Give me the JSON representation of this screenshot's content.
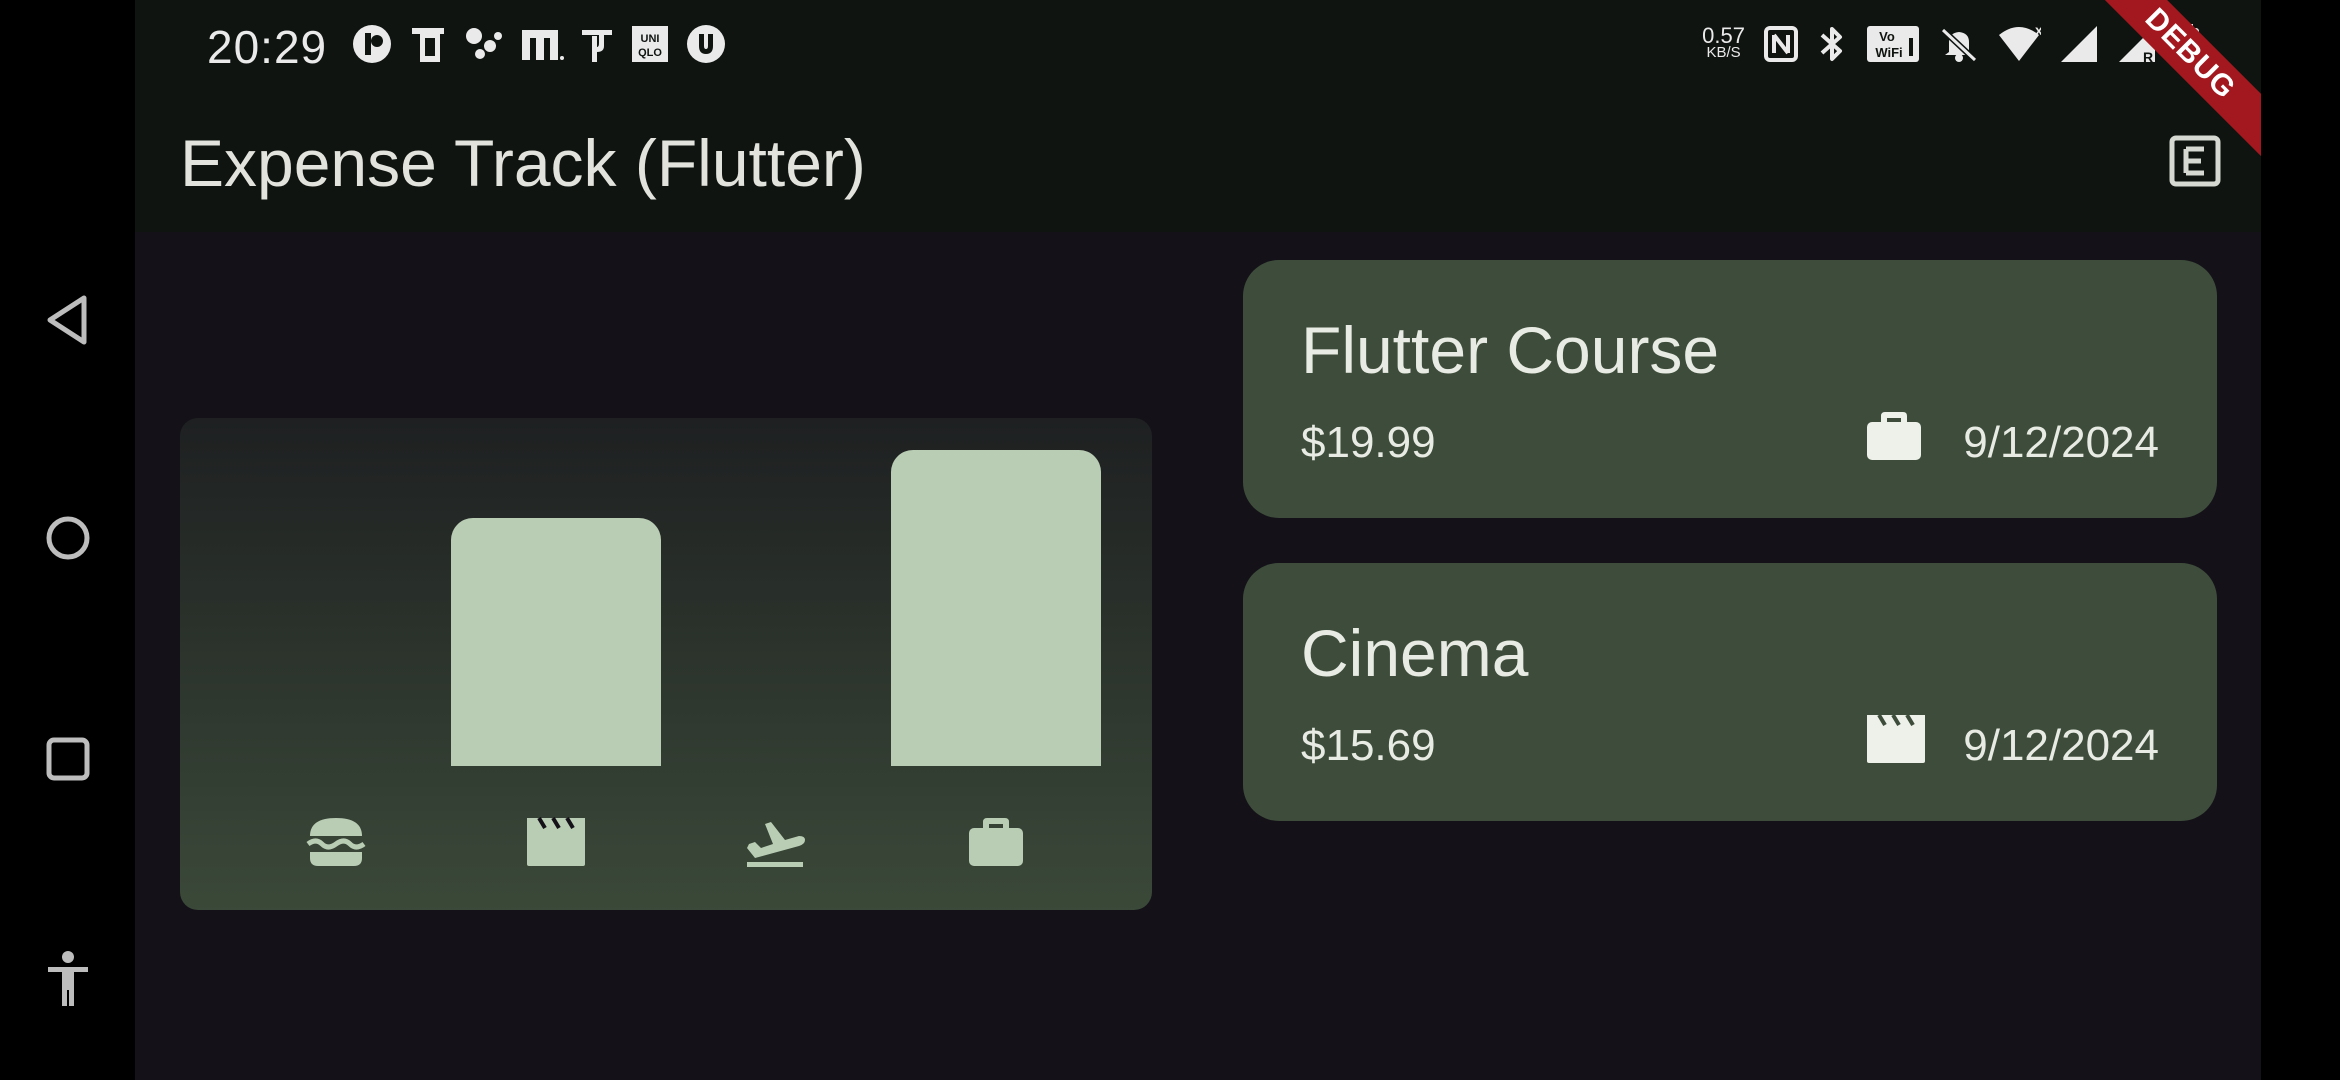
{
  "status_bar": {
    "time": "20:29",
    "net_speed_value": "0.57",
    "net_speed_unit": "KB/S",
    "notification_icons": [
      "app-icon",
      "sim-icon",
      "assistant-icon",
      "m-icon",
      "phonepe-icon",
      "uniqlo-icon",
      "u-icon"
    ],
    "system_icons": [
      "nfc-icon",
      "bluetooth-icon",
      "vowifi-icon",
      "mute-icon",
      "wifi-icon",
      "signal-icon",
      "signal-roaming-icon",
      "battery-icon"
    ]
  },
  "app_bar": {
    "title": "Expense Track (Flutter)",
    "action_icon": "add-expense-icon",
    "debug_banner": "DEBUG"
  },
  "chart_data": {
    "type": "bar",
    "categories": [
      "food",
      "leisure",
      "travel",
      "work"
    ],
    "category_icons": [
      "burger-icon",
      "movie-icon",
      "flight-icon",
      "work-icon"
    ],
    "values": [
      0,
      15.69,
      0,
      19.99
    ],
    "ylim": [
      0,
      19.99
    ],
    "bar_color": "#b9cdb4"
  },
  "expenses": [
    {
      "title": "Flutter Course",
      "amount": "$19.99",
      "icon": "work-icon",
      "date": "9/12/2024"
    },
    {
      "title": "Cinema",
      "amount": "$15.69",
      "icon": "movie-icon",
      "date": "9/12/2024"
    }
  ],
  "nav": {
    "buttons": [
      "back-button",
      "home-button",
      "recents-button",
      "accessibility-button"
    ]
  },
  "colors": {
    "background": "#141218",
    "appbar": "#0f1411",
    "card": "#3e4d3b",
    "accent": "#b9cdb4",
    "debug": "#a3181f"
  }
}
